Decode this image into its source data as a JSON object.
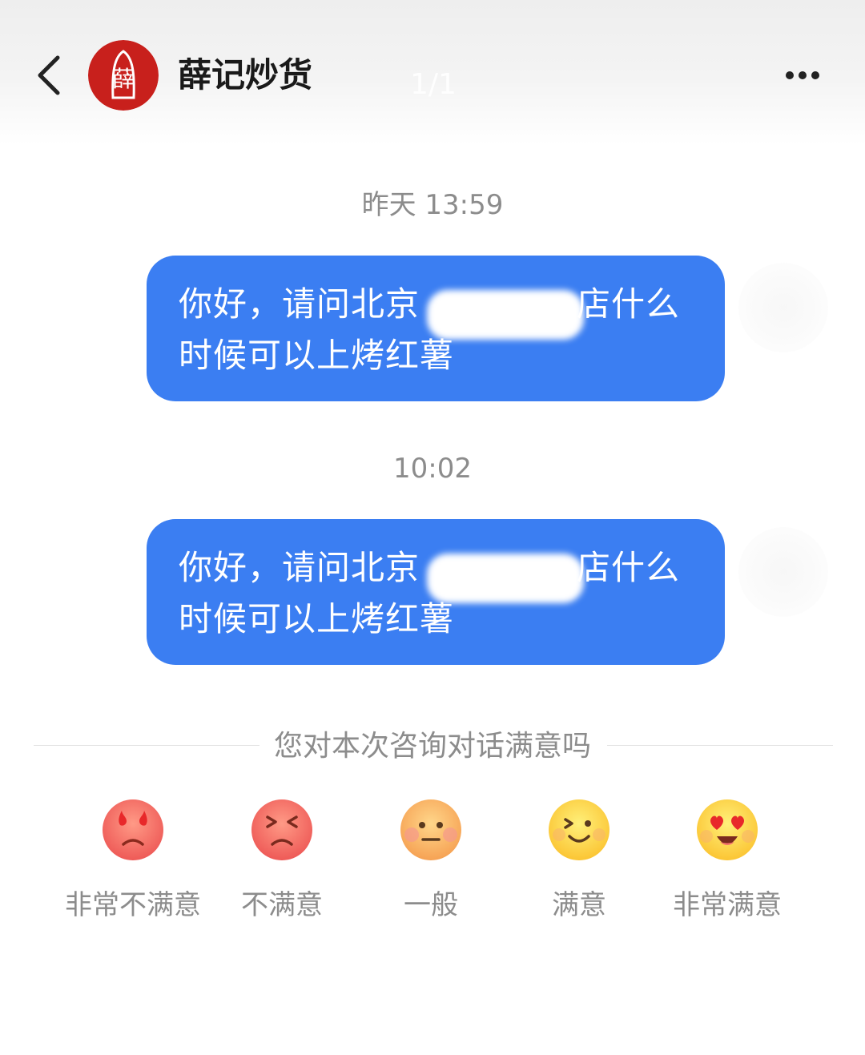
{
  "header": {
    "title": "薛记炒货",
    "page_indicator": "1/1",
    "avatar_char": "薛"
  },
  "messages": [
    {
      "timestamp": "昨天 13:59",
      "text_before": "你好，请问北京",
      "text_after": "店什么时候可以上烤红薯"
    },
    {
      "timestamp": "10:02",
      "text_before": "你好，请问北京",
      "text_after": "店什么时候可以上烤红薯"
    }
  ],
  "survey": {
    "question": "您对本次咨询对话满意吗",
    "options": [
      {
        "label": "非常不满意",
        "icon": "very-angry-face-icon"
      },
      {
        "label": "不满意",
        "icon": "angry-face-icon"
      },
      {
        "label": "一般",
        "icon": "neutral-face-icon"
      },
      {
        "label": "满意",
        "icon": "smiling-face-icon"
      },
      {
        "label": "非常满意",
        "icon": "heart-eyes-face-icon"
      }
    ]
  },
  "colors": {
    "bubble": "#3b7ef2",
    "brand_red": "#c8201c",
    "muted_text": "#8c8c8c"
  }
}
